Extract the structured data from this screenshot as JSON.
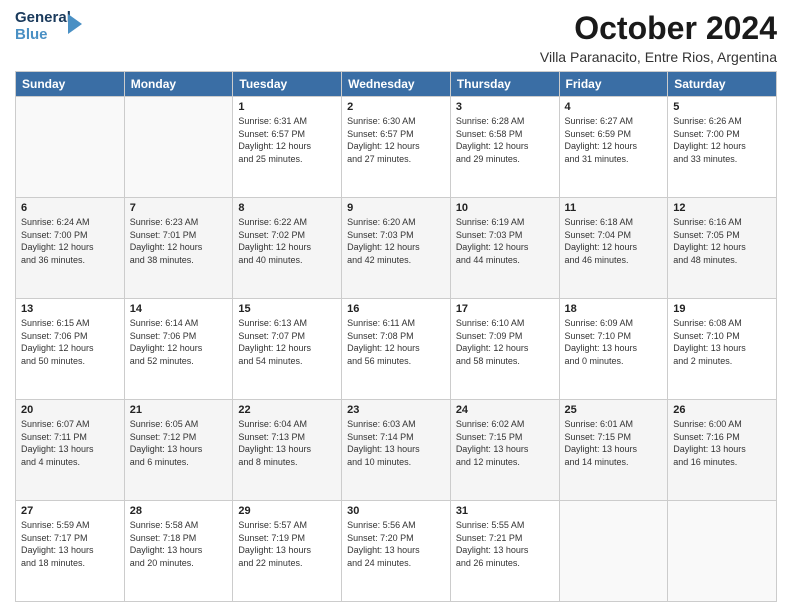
{
  "logo": {
    "line1": "General",
    "line2": "Blue"
  },
  "title": "October 2024",
  "location": "Villa Paranacito, Entre Rios, Argentina",
  "weekdays": [
    "Sunday",
    "Monday",
    "Tuesday",
    "Wednesday",
    "Thursday",
    "Friday",
    "Saturday"
  ],
  "weeks": [
    [
      {
        "day": "",
        "info": ""
      },
      {
        "day": "",
        "info": ""
      },
      {
        "day": "1",
        "info": "Sunrise: 6:31 AM\nSunset: 6:57 PM\nDaylight: 12 hours\nand 25 minutes."
      },
      {
        "day": "2",
        "info": "Sunrise: 6:30 AM\nSunset: 6:57 PM\nDaylight: 12 hours\nand 27 minutes."
      },
      {
        "day": "3",
        "info": "Sunrise: 6:28 AM\nSunset: 6:58 PM\nDaylight: 12 hours\nand 29 minutes."
      },
      {
        "day": "4",
        "info": "Sunrise: 6:27 AM\nSunset: 6:59 PM\nDaylight: 12 hours\nand 31 minutes."
      },
      {
        "day": "5",
        "info": "Sunrise: 6:26 AM\nSunset: 7:00 PM\nDaylight: 12 hours\nand 33 minutes."
      }
    ],
    [
      {
        "day": "6",
        "info": "Sunrise: 6:24 AM\nSunset: 7:00 PM\nDaylight: 12 hours\nand 36 minutes."
      },
      {
        "day": "7",
        "info": "Sunrise: 6:23 AM\nSunset: 7:01 PM\nDaylight: 12 hours\nand 38 minutes."
      },
      {
        "day": "8",
        "info": "Sunrise: 6:22 AM\nSunset: 7:02 PM\nDaylight: 12 hours\nand 40 minutes."
      },
      {
        "day": "9",
        "info": "Sunrise: 6:20 AM\nSunset: 7:03 PM\nDaylight: 12 hours\nand 42 minutes."
      },
      {
        "day": "10",
        "info": "Sunrise: 6:19 AM\nSunset: 7:03 PM\nDaylight: 12 hours\nand 44 minutes."
      },
      {
        "day": "11",
        "info": "Sunrise: 6:18 AM\nSunset: 7:04 PM\nDaylight: 12 hours\nand 46 minutes."
      },
      {
        "day": "12",
        "info": "Sunrise: 6:16 AM\nSunset: 7:05 PM\nDaylight: 12 hours\nand 48 minutes."
      }
    ],
    [
      {
        "day": "13",
        "info": "Sunrise: 6:15 AM\nSunset: 7:06 PM\nDaylight: 12 hours\nand 50 minutes."
      },
      {
        "day": "14",
        "info": "Sunrise: 6:14 AM\nSunset: 7:06 PM\nDaylight: 12 hours\nand 52 minutes."
      },
      {
        "day": "15",
        "info": "Sunrise: 6:13 AM\nSunset: 7:07 PM\nDaylight: 12 hours\nand 54 minutes."
      },
      {
        "day": "16",
        "info": "Sunrise: 6:11 AM\nSunset: 7:08 PM\nDaylight: 12 hours\nand 56 minutes."
      },
      {
        "day": "17",
        "info": "Sunrise: 6:10 AM\nSunset: 7:09 PM\nDaylight: 12 hours\nand 58 minutes."
      },
      {
        "day": "18",
        "info": "Sunrise: 6:09 AM\nSunset: 7:10 PM\nDaylight: 13 hours\nand 0 minutes."
      },
      {
        "day": "19",
        "info": "Sunrise: 6:08 AM\nSunset: 7:10 PM\nDaylight: 13 hours\nand 2 minutes."
      }
    ],
    [
      {
        "day": "20",
        "info": "Sunrise: 6:07 AM\nSunset: 7:11 PM\nDaylight: 13 hours\nand 4 minutes."
      },
      {
        "day": "21",
        "info": "Sunrise: 6:05 AM\nSunset: 7:12 PM\nDaylight: 13 hours\nand 6 minutes."
      },
      {
        "day": "22",
        "info": "Sunrise: 6:04 AM\nSunset: 7:13 PM\nDaylight: 13 hours\nand 8 minutes."
      },
      {
        "day": "23",
        "info": "Sunrise: 6:03 AM\nSunset: 7:14 PM\nDaylight: 13 hours\nand 10 minutes."
      },
      {
        "day": "24",
        "info": "Sunrise: 6:02 AM\nSunset: 7:15 PM\nDaylight: 13 hours\nand 12 minutes."
      },
      {
        "day": "25",
        "info": "Sunrise: 6:01 AM\nSunset: 7:15 PM\nDaylight: 13 hours\nand 14 minutes."
      },
      {
        "day": "26",
        "info": "Sunrise: 6:00 AM\nSunset: 7:16 PM\nDaylight: 13 hours\nand 16 minutes."
      }
    ],
    [
      {
        "day": "27",
        "info": "Sunrise: 5:59 AM\nSunset: 7:17 PM\nDaylight: 13 hours\nand 18 minutes."
      },
      {
        "day": "28",
        "info": "Sunrise: 5:58 AM\nSunset: 7:18 PM\nDaylight: 13 hours\nand 20 minutes."
      },
      {
        "day": "29",
        "info": "Sunrise: 5:57 AM\nSunset: 7:19 PM\nDaylight: 13 hours\nand 22 minutes."
      },
      {
        "day": "30",
        "info": "Sunrise: 5:56 AM\nSunset: 7:20 PM\nDaylight: 13 hours\nand 24 minutes."
      },
      {
        "day": "31",
        "info": "Sunrise: 5:55 AM\nSunset: 7:21 PM\nDaylight: 13 hours\nand 26 minutes."
      },
      {
        "day": "",
        "info": ""
      },
      {
        "day": "",
        "info": ""
      }
    ]
  ]
}
